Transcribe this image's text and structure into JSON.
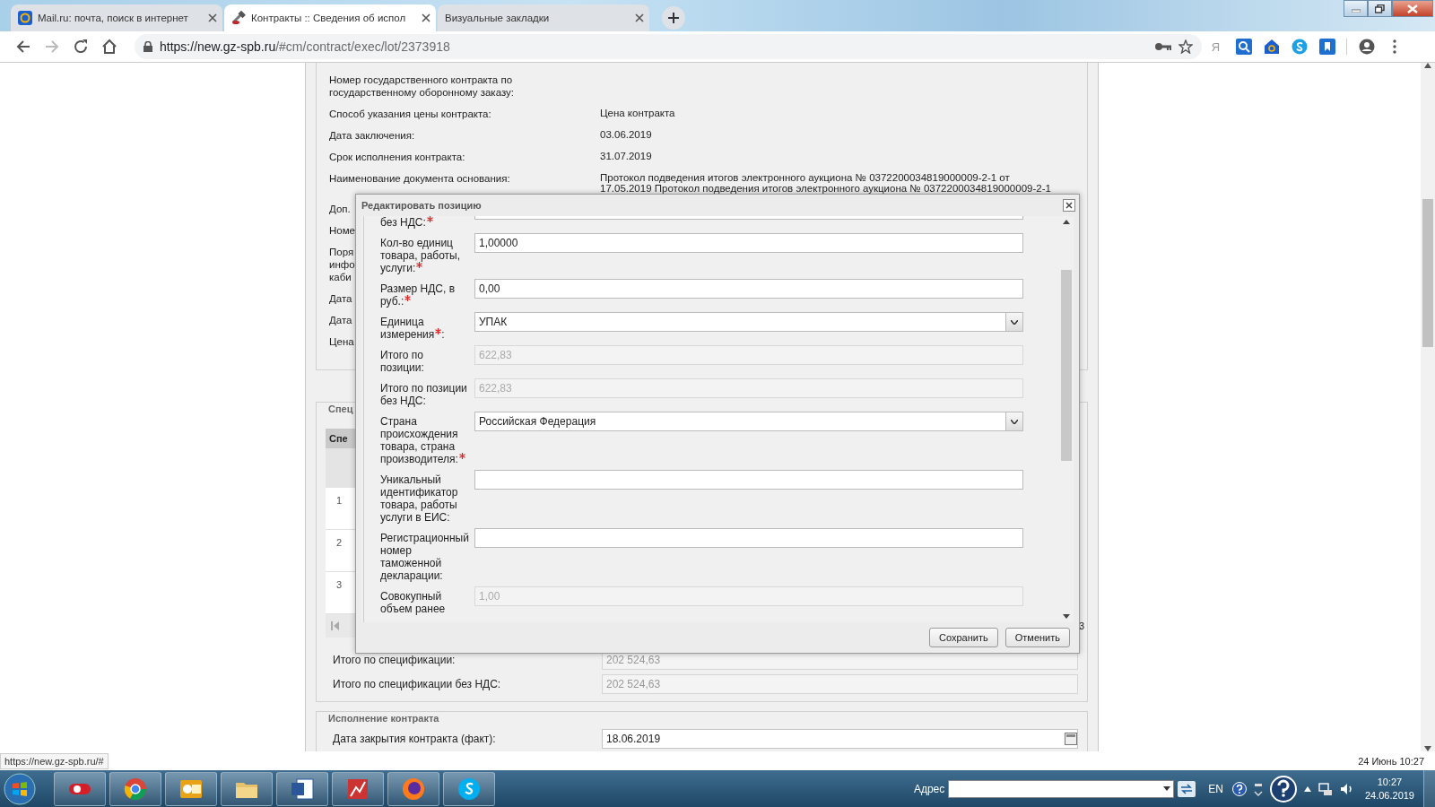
{
  "browser": {
    "tabs": [
      {
        "title": "Mail.ru: почта, поиск в интернет",
        "kind": "mail",
        "selected": false
      },
      {
        "title": "Контракты :: Сведения об испол",
        "kind": "tools",
        "selected": true
      },
      {
        "title": "Визуальные закладки",
        "kind": "none",
        "selected": false
      }
    ],
    "url_host": "https://new.gz-spb.ru",
    "url_path": "/#cm/contract/exec/lot/2373918",
    "extension_letter": "Я"
  },
  "page": {
    "rows": [
      {
        "label": [
          "Номер государственного контракта по",
          "государственному оборонному заказу:"
        ],
        "value": []
      },
      {
        "label": [
          "Способ указания цены контракта:"
        ],
        "value": [
          "Цена контракта"
        ]
      },
      {
        "label": [
          "Дата заключения:"
        ],
        "value": [
          "03.06.2019"
        ]
      },
      {
        "label": [
          "Срок исполнения контракта:"
        ],
        "value": [
          "31.07.2019"
        ]
      },
      {
        "label": [
          "Наименование документа основания:"
        ],
        "value": [
          "Протокол подведения итогов электронного аукциона № 0372200034819000009-2-1 от",
          "17.05.2019 Протокол подведения итогов электронного аукциона № 0372200034819000009-2-1"
        ]
      },
      {
        "label": [
          "Доп."
        ],
        "value": []
      },
      {
        "label": [
          "Номе"
        ],
        "value": []
      },
      {
        "label": [
          "Поря",
          "инфо",
          "каби"
        ],
        "value": []
      },
      {
        "label": [
          "Дата"
        ],
        "value": []
      },
      {
        "label": [
          "Дата"
        ],
        "value": []
      },
      {
        "label": [
          "Цена"
        ],
        "value": []
      }
    ],
    "spec": {
      "legend": "Спец",
      "grid_header": "Спе",
      "row_numbers": [
        "1",
        "2",
        "3"
      ],
      "pager_text": "3"
    },
    "totals": [
      {
        "label": "Итого по спецификации:",
        "value": "202 524,63"
      },
      {
        "label": "Итого по спецификации без НДС:",
        "value": "202 524,63"
      }
    ],
    "execution": {
      "legend": "Исполнение контракта",
      "label": "Дата закрытия контракта (факт):",
      "value": "18.06.2019"
    }
  },
  "dialog": {
    "title": "Редактировать позицию",
    "fields": [
      {
        "label": [
          "без НДС:"
        ],
        "required": true,
        "kind": "cut"
      },
      {
        "label": [
          "Кол-во единиц",
          "товара, работы,",
          "услуги:"
        ],
        "required": true,
        "kind": "text",
        "value": "1,00000"
      },
      {
        "label": [
          "Размер НДС, в",
          "руб.:"
        ],
        "required": true,
        "kind": "text",
        "value": "0,00"
      },
      {
        "label": [
          "Единица",
          "измерения"
        ],
        "suffix": ":",
        "required": true,
        "kind": "select",
        "value": "УПАК"
      },
      {
        "label": [
          "Итого по",
          "позиции:"
        ],
        "required": false,
        "kind": "disabled",
        "value": "622,83"
      },
      {
        "label": [
          "Итого по позиции",
          "без НДС:"
        ],
        "required": false,
        "kind": "disabled",
        "value": "622,83"
      },
      {
        "label": [
          "Страна",
          "происхождения",
          "товара, страна",
          "производителя:"
        ],
        "required": true,
        "kind": "select",
        "value": "Российская Федерация"
      },
      {
        "label": [
          "Уникальный",
          "идентификатор",
          "товара, работы",
          "услуги в ЕИС:"
        ],
        "required": false,
        "kind": "text"
      },
      {
        "label": [
          "Регистрационный",
          "номер",
          "таможенной",
          "декларации:"
        ],
        "required": false,
        "kind": "text"
      },
      {
        "label": [
          "Совокупный",
          "объем ранее"
        ],
        "required": false,
        "kind": "disabled",
        "value": "1,00"
      }
    ],
    "buttons": [
      "Сохранить",
      "Отменить"
    ]
  },
  "status": {
    "link": "https://new.gz-spb.ru/#",
    "datetime": "24 Июнь 10:27"
  },
  "taskbar": {
    "apps": [
      {
        "kind": "pill"
      },
      {
        "kind": "wheel"
      },
      {
        "kind": "mail"
      },
      {
        "kind": "folder"
      },
      {
        "kind": "doc"
      },
      {
        "kind": "chart"
      },
      {
        "kind": "globe"
      },
      {
        "kind": "chat"
      }
    ],
    "address_label": "Адрес",
    "language": "EN",
    "time": "10:27",
    "date": "24.06.2019"
  }
}
